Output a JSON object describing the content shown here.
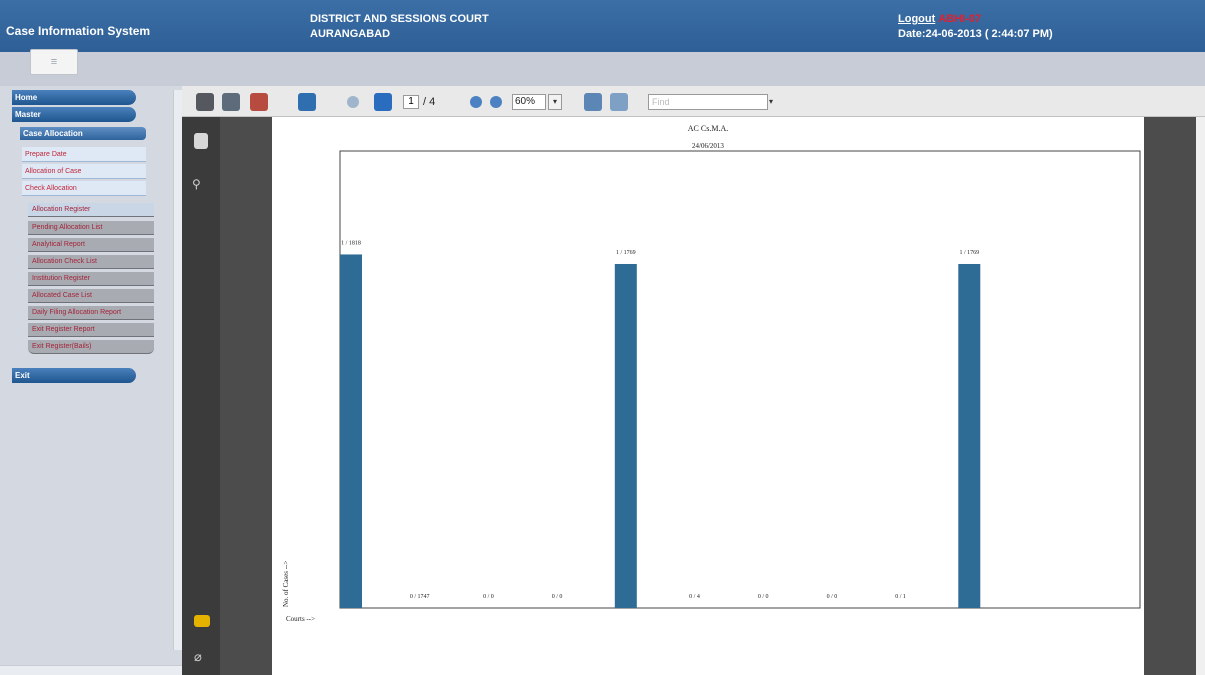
{
  "header": {
    "app_title": "Case Information System",
    "court_line1": "DISTRICT AND SESSIONS COURT",
    "court_line2": "AURANGABAD",
    "logout": "Logout",
    "user": "ABHI-07",
    "date": "Date:24-06-2013 ( 2:44:07 PM)"
  },
  "sidebar": {
    "toggle": "≡",
    "top_items": [
      "Home",
      "Master"
    ],
    "section": "Case Allocation",
    "links": [
      "Prepare Date",
      "Allocation of Case",
      "Check Allocation"
    ],
    "sub_items": [
      "Allocation Register",
      "Pending Allocation List",
      "Analytical Report",
      "Allocation Check List",
      "Institution Register",
      "Allocated Case List",
      "Daily Filing Allocation Report",
      "Exit Register Report",
      "Exit Register(Bails)"
    ],
    "bottom_item": "Exit"
  },
  "toolbar": {
    "page": "1",
    "page_total": "/ 4",
    "zoom": "60%",
    "find_placeholder": "Find"
  },
  "report": {
    "title": "AC Cs.M.A.",
    "date": "24/06/2013",
    "ylabel": "No. of Cases -->",
    "xlabel": "Courts -->"
  },
  "chart_data": {
    "type": "bar",
    "ylabel": "No. of Cases -->",
    "xlabel": "Courts -->",
    "bar_color": "#2e6b95",
    "ylim": [
      0,
      2350
    ],
    "bars": [
      {
        "label": "1 / 1818",
        "value": 1818
      },
      {
        "label": "0 / 1747",
        "value": 0
      },
      {
        "label": "0 / 0",
        "value": 0
      },
      {
        "label": "0 / 0",
        "value": 0
      },
      {
        "label": "1 / 1769",
        "value": 1769
      },
      {
        "label": "0 / 4",
        "value": 0
      },
      {
        "label": "0 / 0",
        "value": 0
      },
      {
        "label": "0 / 0",
        "value": 0
      },
      {
        "label": "0 / 1",
        "value": 0
      },
      {
        "label": "1 / 1769",
        "value": 1769
      }
    ]
  }
}
